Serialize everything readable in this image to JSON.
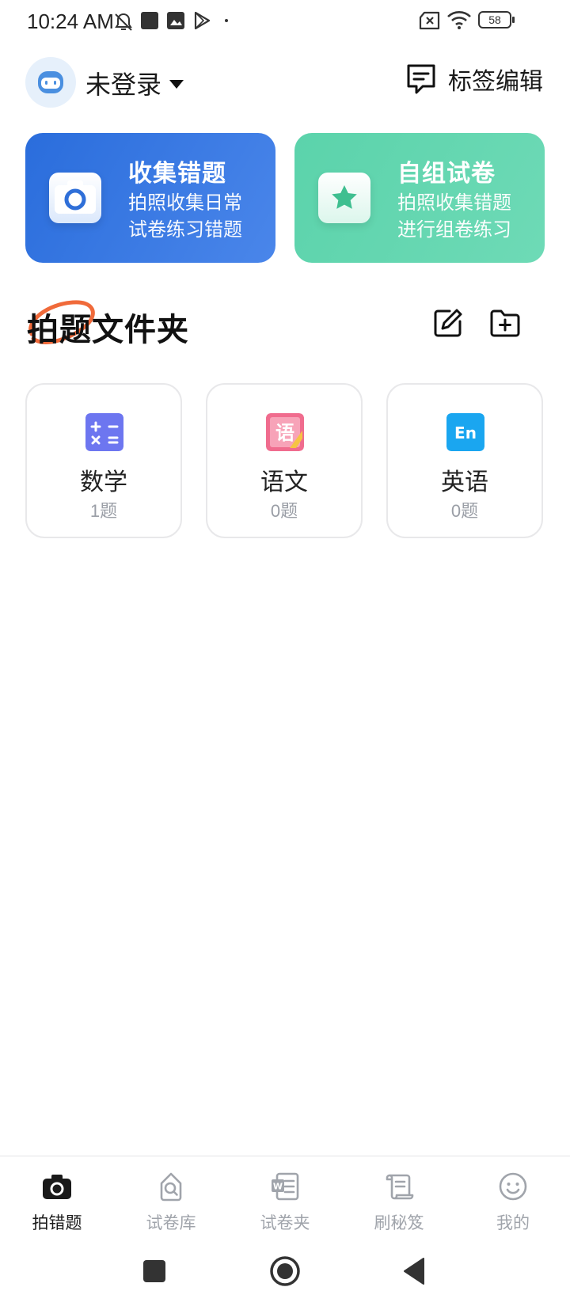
{
  "status_bar": {
    "time": "10:24 AM",
    "battery": "58",
    "icons": [
      "mute-bell-icon",
      "square-app-icon",
      "image-app-icon",
      "play-store-icon",
      "dot-icon",
      "no-sim-icon",
      "wifi-icon",
      "battery-icon"
    ]
  },
  "header": {
    "login_label": "未登录",
    "tag_edit_label": "标签编辑"
  },
  "cards": {
    "collect": {
      "title": "收集错题",
      "line1": "拍照收集日常",
      "line2": "试卷练习错题"
    },
    "compose": {
      "title": "自组试卷",
      "line1": "拍照收集错题",
      "line2": "进行组卷练习"
    }
  },
  "folder": {
    "title": "拍题文件夹",
    "subjects": [
      {
        "name": "数学",
        "count": "1题",
        "icon": "math-icon"
      },
      {
        "name": "语文",
        "count": "0题",
        "icon": "chinese-icon"
      },
      {
        "name": "英语",
        "count": "0题",
        "icon": "english-icon"
      }
    ]
  },
  "tabs": [
    {
      "label": "拍错题",
      "icon": "camera-icon",
      "active": true
    },
    {
      "label": "试卷库",
      "icon": "search-doc-icon",
      "active": false
    },
    {
      "label": "试卷夹",
      "icon": "word-doc-icon",
      "active": false
    },
    {
      "label": "刷秘笈",
      "icon": "scroll-icon",
      "active": false
    },
    {
      "label": "我的",
      "icon": "smile-icon",
      "active": false
    }
  ],
  "colors": {
    "collect_card": "#3577e2",
    "compose_card": "#62d6b0",
    "highlight_ring": "#f06a3a",
    "tab_active": "#1a1a1a",
    "tab_inactive": "#a0a4ab"
  }
}
